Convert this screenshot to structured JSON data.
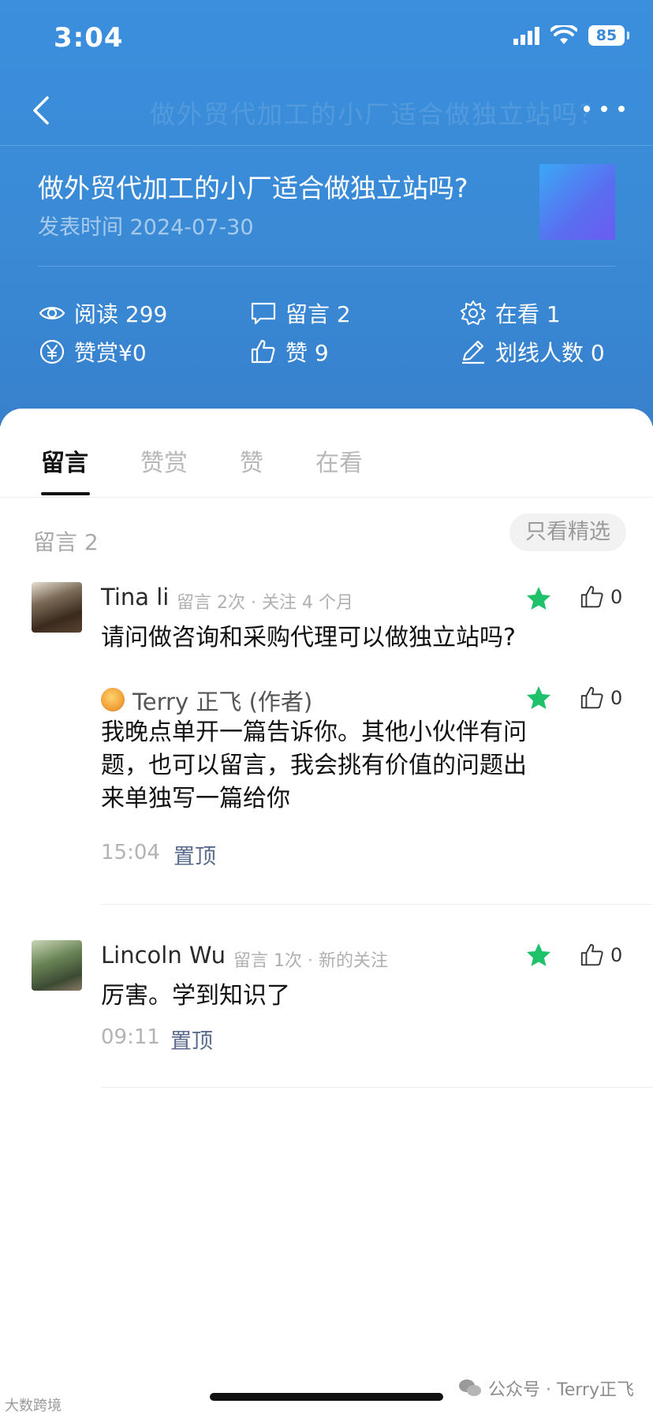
{
  "status_bar": {
    "time": "3:04",
    "battery": "85"
  },
  "nav": {
    "ghost_title": "做外贸代加工的小厂适合做独立站吗？"
  },
  "article": {
    "title": "做外贸代加工的小厂适合做独立站吗?",
    "publish": "发表时间 2024-07-30"
  },
  "stats": {
    "reads": "阅读 299",
    "comments": "留言 2",
    "watching": "在看 1",
    "tips": "赞赏¥0",
    "likes": "赞 9",
    "underlines": "划线人数 0"
  },
  "tabs": [
    "留言",
    "赞赏",
    "赞",
    "在看"
  ],
  "comments_section": {
    "count_label": "留言 2",
    "filter_button": "只看精选"
  },
  "comments": [
    {
      "name": "Tina li",
      "meta": "留言 2次 · 关注 4 个月",
      "text": "请问做咨询和采购代理可以做独立站吗?",
      "likes": "0",
      "reply": {
        "name": "Terry 正飞 (作者)",
        "text": "我晚点单开一篇告诉你。其他小伙伴有问题，也可以留言，我会挑有价值的问题出来单独写一篇给你",
        "likes": "0"
      },
      "time": "15:04",
      "pin": "置顶"
    },
    {
      "name": "Lincoln Wu",
      "meta": "留言 1次 · 新的关注",
      "text": "厉害。学到知识了",
      "likes": "0",
      "time": "09:11",
      "pin": "置顶"
    }
  ],
  "watermark": {
    "left": "大数跨境",
    "right": "公众号 · Terry正飞"
  },
  "colors": {
    "header_blue": "#3a8ad6",
    "star_green": "#1fc16b",
    "pin_blue": "#5b6b8c"
  }
}
